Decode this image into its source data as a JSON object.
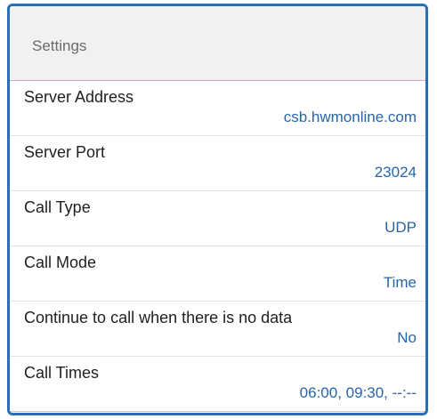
{
  "header": {
    "title": "Settings"
  },
  "settings": [
    {
      "label": "Server Address",
      "value": "csb.hwmonline.com"
    },
    {
      "label": "Server Port",
      "value": "23024"
    },
    {
      "label": "Call Type",
      "value": "UDP"
    },
    {
      "label": "Call Mode",
      "value": "Time"
    },
    {
      "label": "Continue to call when there is no data",
      "value": "No"
    },
    {
      "label": "Call Times",
      "value": "06:00, 09:30, --:--"
    }
  ],
  "colors": {
    "frame_border": "#2a6fb3",
    "value_text": "#2765a8",
    "header_bg": "#f1f1f1",
    "header_divider": "#d8a7c9"
  }
}
